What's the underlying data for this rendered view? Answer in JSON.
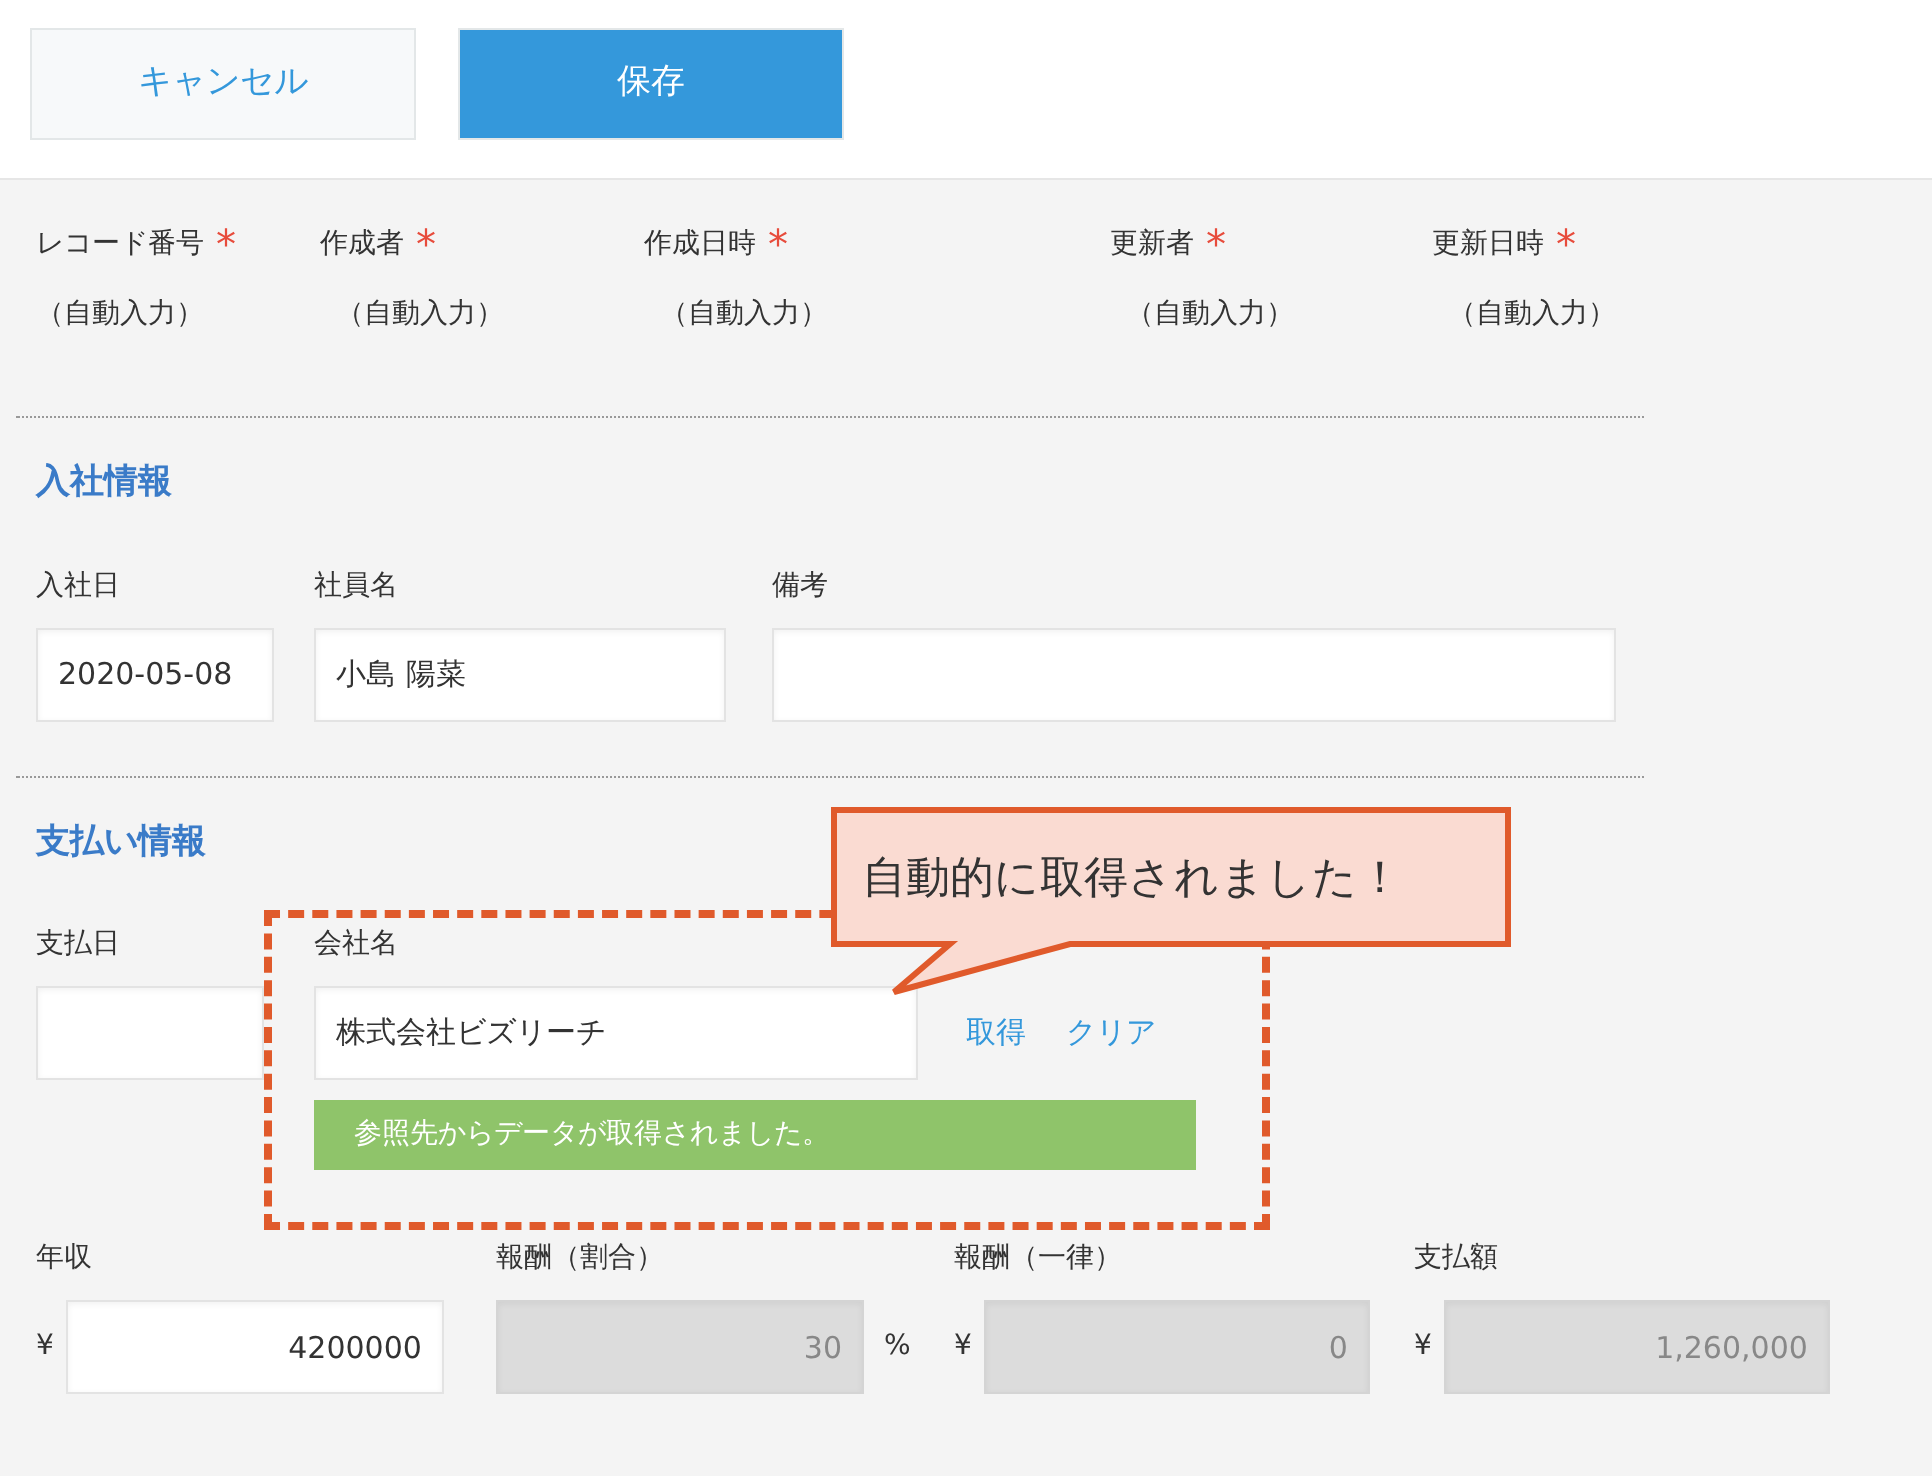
{
  "buttons": [
    {
      "label": "キャンセル",
      "kind": "secondary"
    },
    {
      "label": "保存",
      "kind": "primary"
    }
  ],
  "system_fields": [
    {
      "label": "レコード番号",
      "required_mark": "*",
      "value": "（自動入力）"
    },
    {
      "label": "作成者",
      "required_mark": "*",
      "value": "（自動入力）"
    },
    {
      "label": "作成日時",
      "required_mark": "*",
      "value": "（自動入力）"
    },
    {
      "label": "更新者",
      "required_mark": "*",
      "value": "（自動入力）"
    },
    {
      "label": "更新日時",
      "required_mark": "*",
      "value": "（自動入力）"
    }
  ],
  "sections": [
    {
      "title": "入社情報",
      "rows": [
        [
          {
            "kind": "text",
            "label": "入社日",
            "value": "2020-05-08",
            "disabled": false
          },
          {
            "kind": "text",
            "label": "社員名",
            "value": "小島 陽菜",
            "disabled": false
          },
          {
            "kind": "text",
            "label": "備考",
            "disabled": false
          }
        ]
      ]
    },
    {
      "title": "支払い情報",
      "rows": [
        [
          {
            "kind": "text",
            "label": "支払日",
            "disabled": false
          },
          {
            "kind": "lookup",
            "label": "会社名",
            "value": "株式会社ビズリーチ",
            "disabled": false,
            "actions": [
              "取得",
              "クリア"
            ],
            "message": "参照先からデータが取得されました。"
          }
        ],
        [
          {
            "kind": "number",
            "label": "年収",
            "prefix": "¥",
            "value": "4200000",
            "disabled": false
          },
          {
            "kind": "number",
            "label": "報酬（割合）",
            "value": "30",
            "suffix": "%",
            "disabled": true
          },
          {
            "kind": "number",
            "label": "報酬（一律）",
            "prefix": "¥",
            "value": "0",
            "disabled": true
          },
          {
            "kind": "number",
            "label": "支払額",
            "prefix": "¥",
            "value": "1,260,000",
            "disabled": true
          }
        ]
      ]
    }
  ],
  "callout": {
    "text": "自動的に取得されました！"
  }
}
